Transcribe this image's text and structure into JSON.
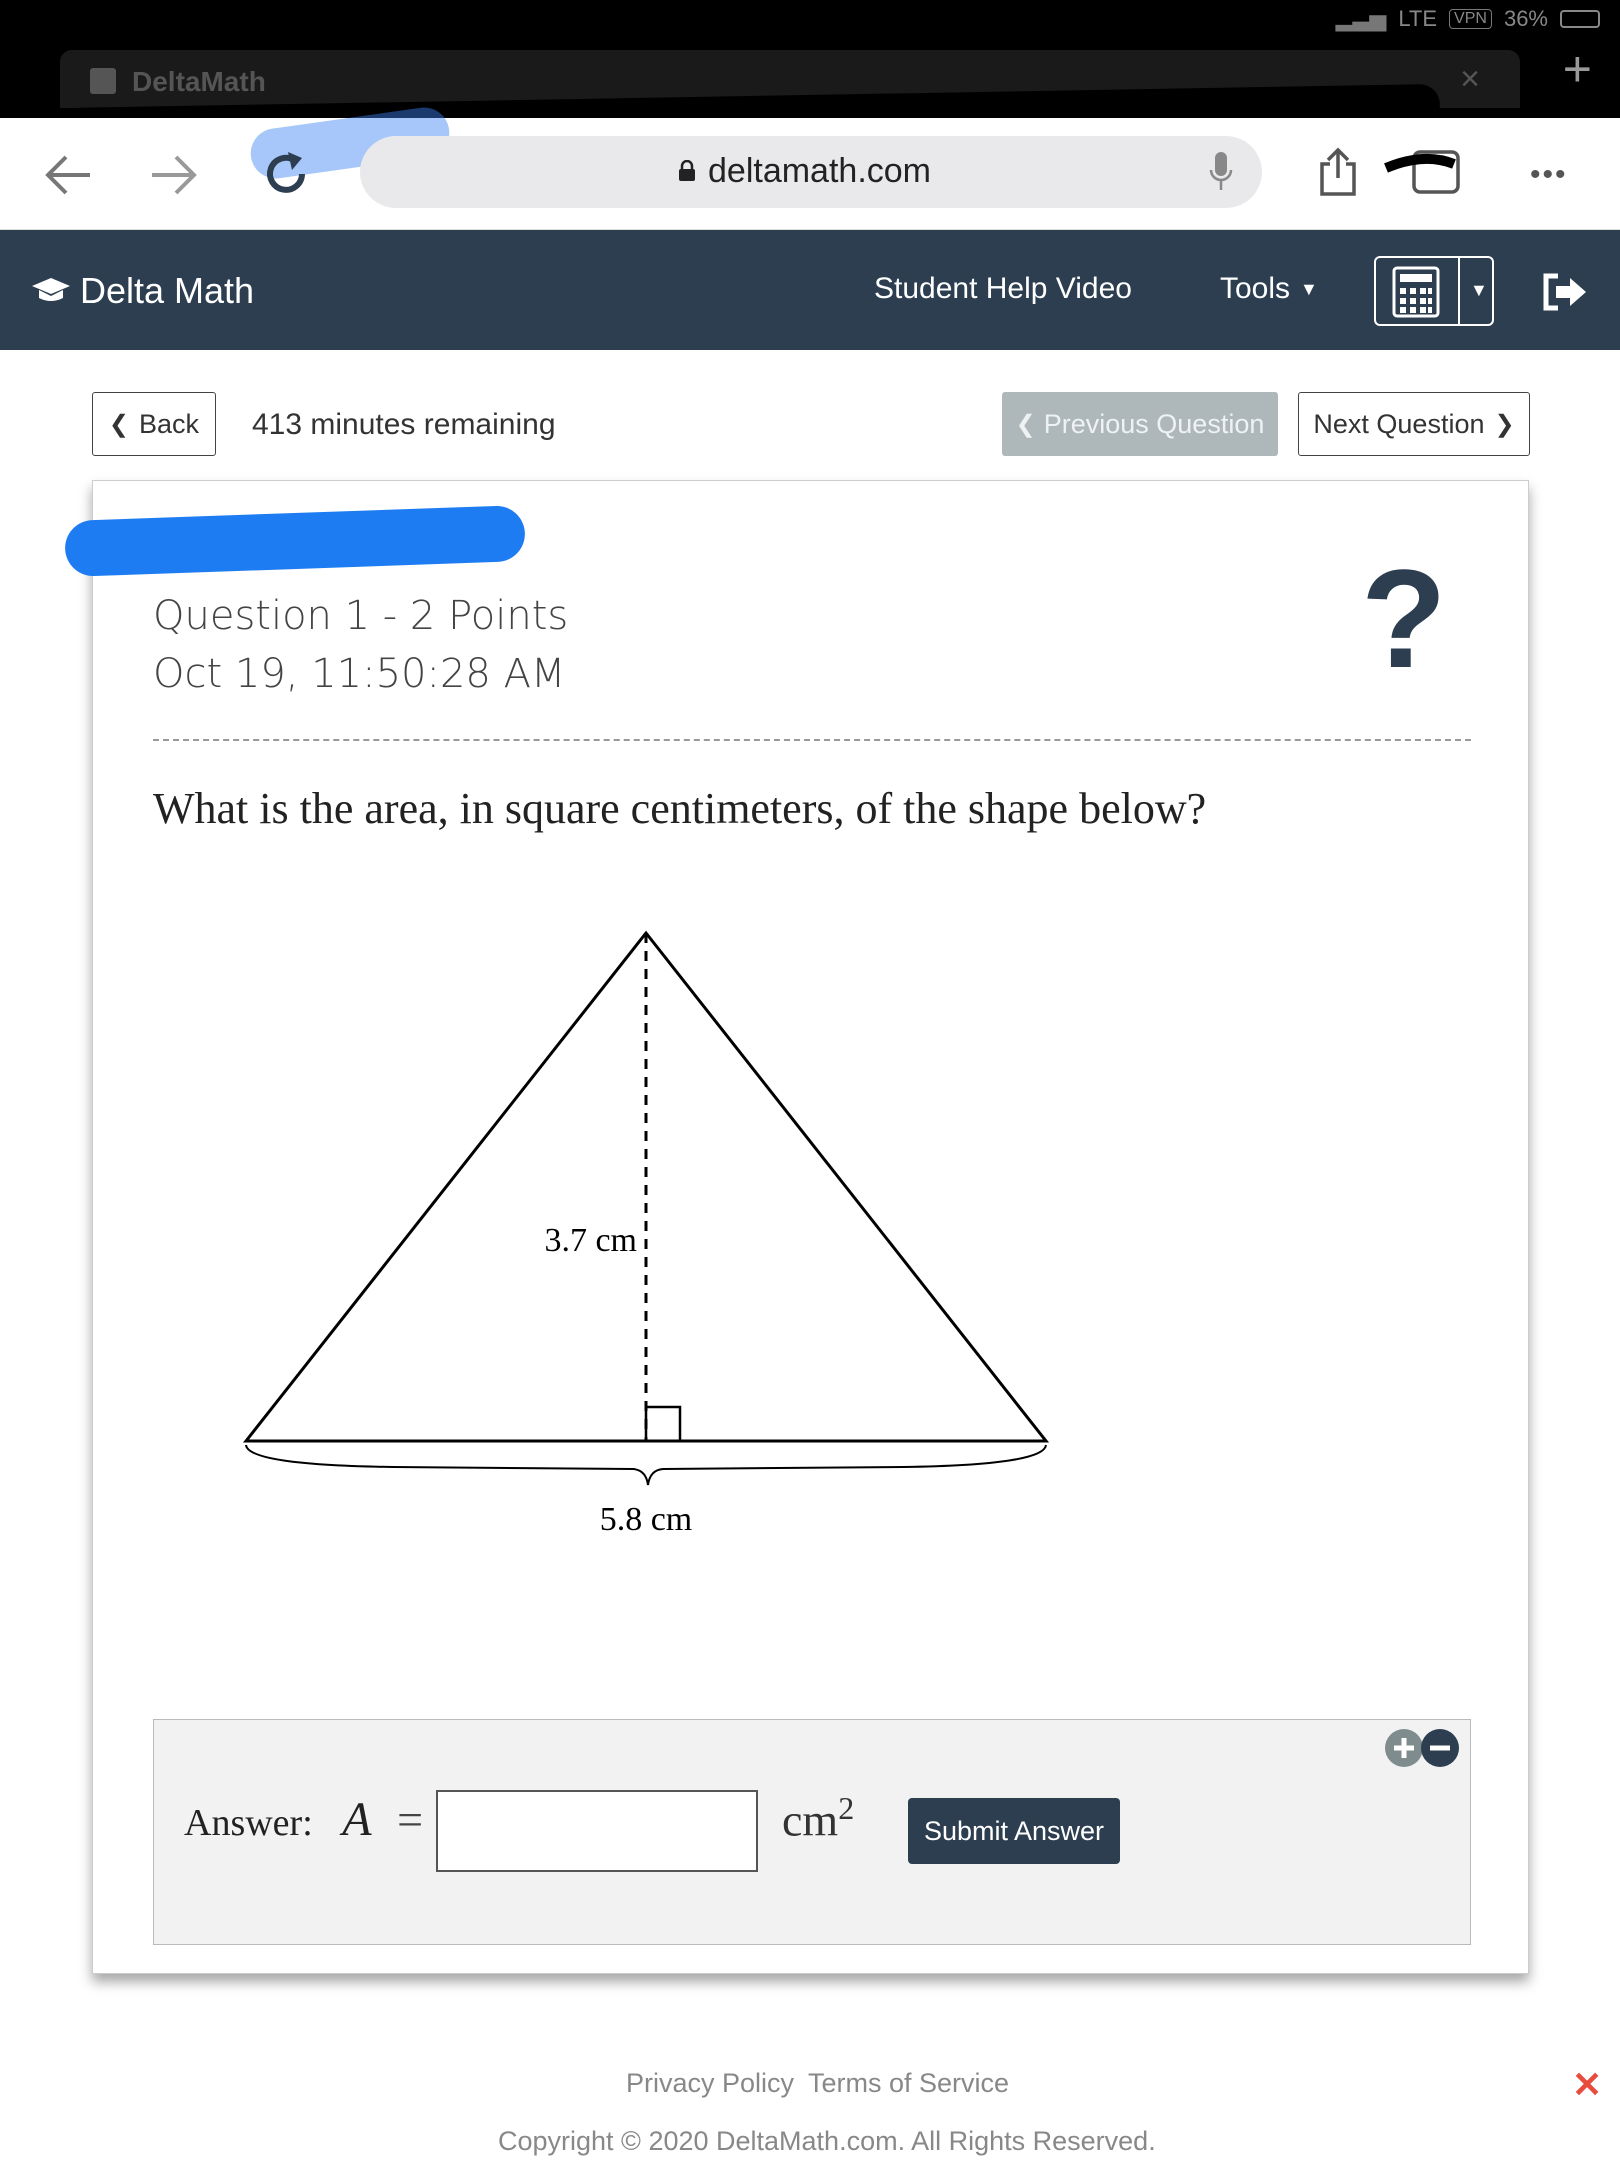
{
  "browser": {
    "tab_title": "DeltaMath",
    "url": "deltamath.com",
    "status": "LTE",
    "vpn": "VPN",
    "battery": "36%"
  },
  "app": {
    "brand": "Delta Math",
    "help_video": "Student Help Video",
    "tools": "Tools"
  },
  "nav": {
    "back": "Back",
    "minutes_remaining": "413 minutes remaining",
    "previous": "Previous Question",
    "next": "Next Question"
  },
  "question": {
    "header": "Question 1 - 2 Points",
    "timestamp": "Oct 19, 11:50:28 AM",
    "help_symbol": "?",
    "prompt": "What is the area, in square centimeters, of the shape below?",
    "height_label": "3.7 cm",
    "base_label": "5.8 cm"
  },
  "answer": {
    "label": "Answer:",
    "variable": "A",
    "equals": "=",
    "value": "",
    "unit": "cm",
    "unit_exp": "2",
    "submit": "Submit Answer"
  },
  "footer": {
    "privacy": "Privacy Policy",
    "terms": "Terms of Service",
    "copyright": "Copyright © 2020 DeltaMath.com. All Rights Reserved."
  },
  "colors": {
    "header_bg": "#2c3e50",
    "disabled_button": "#aeb8bb",
    "dismiss": "#e74c3c"
  }
}
